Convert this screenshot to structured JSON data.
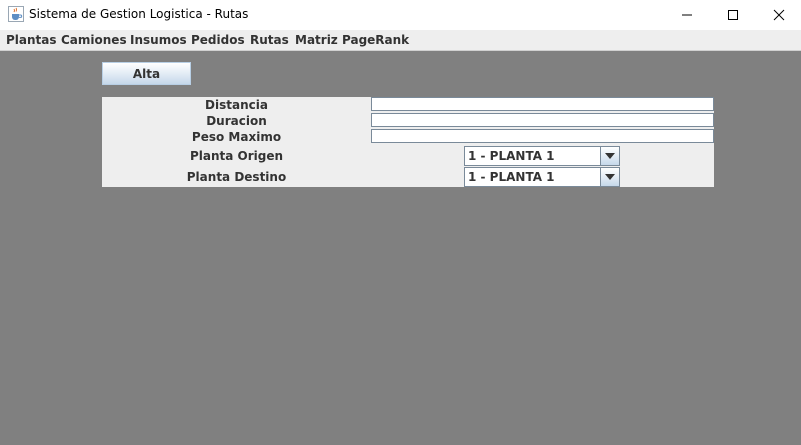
{
  "window": {
    "title": "Sistema de Gestion Logistica - Rutas",
    "app_icon": "java-cup-icon",
    "controls": [
      "minimize-icon",
      "maximize-icon",
      "close-icon"
    ]
  },
  "menubar": {
    "items": [
      "Plantas",
      "Camiones",
      "Insumos",
      "Pedidos",
      "Rutas",
      "Matriz",
      "PageRank"
    ]
  },
  "toolbar": {
    "alta_label": "Alta"
  },
  "form": {
    "distancia": {
      "label": "Distancia",
      "value": ""
    },
    "duracion": {
      "label": "Duracion",
      "value": ""
    },
    "peso_maximo": {
      "label": "Peso Maximo",
      "value": ""
    },
    "planta_origen": {
      "label": "Planta Origen",
      "selected": "1 - PLANTA 1"
    },
    "planta_destino": {
      "label": "Planta Destino",
      "selected": "1 - PLANTA 1"
    }
  },
  "colors": {
    "background": "#808080",
    "panel": "#eeeeee",
    "button_gradient_bottom": "#c6d8ea",
    "field_border": "#7a8a99"
  }
}
